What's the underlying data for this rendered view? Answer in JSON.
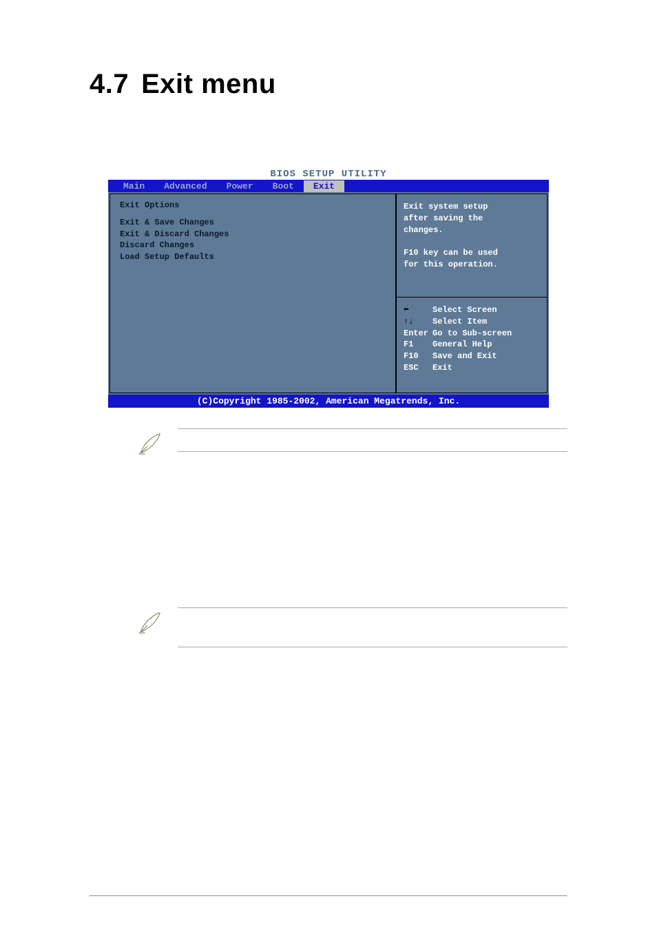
{
  "heading": {
    "number": "4.7",
    "title": "Exit menu"
  },
  "bios": {
    "title": "BIOS SETUP UTILITY",
    "tabs": [
      "Main",
      "Advanced",
      "Power",
      "Boot",
      "Exit"
    ],
    "active_tab_index": 4,
    "left": {
      "header": "Exit Options",
      "items": [
        "Exit & Save Changes",
        "Exit & Discard Changes",
        "Discard Changes",
        "",
        "Load Setup Defaults"
      ]
    },
    "right_top": "Exit system setup\nafter saving the\nchanges.\n\nF10 key can be used\nfor this operation.",
    "right_bottom": [
      {
        "key": "←→",
        "label": "Select Screen"
      },
      {
        "key": "↑↓",
        "label": "Select Item"
      },
      {
        "key": "Enter",
        "label": "Go to Sub-screen"
      },
      {
        "key": "F1",
        "label": "General Help"
      },
      {
        "key": "F10",
        "label": "Save and Exit"
      },
      {
        "key": "ESC",
        "label": "Exit"
      }
    ],
    "footer": "(C)Copyright 1985-2002, American Megatrends, Inc."
  }
}
